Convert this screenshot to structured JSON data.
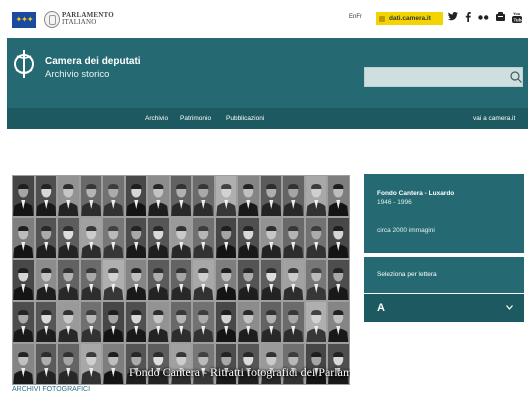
{
  "topbar": {
    "parliament_line1": "PARLAMENTO",
    "parliament_line2": "ITALIANO",
    "language": "EnFr",
    "dati_label": "dati.camera.it",
    "socials": [
      "twitter-icon",
      "facebook-icon",
      "flickr-icon",
      "rss-icon",
      "youtube-icon"
    ]
  },
  "header": {
    "title": "Camera dei deputati",
    "subtitle": "Archivio storico",
    "search_value": ""
  },
  "nav": {
    "items": [
      "Archivio",
      "Patrimonio",
      "Pubblicazioni"
    ],
    "external": "vai a camera.it"
  },
  "content": {
    "caption": "Fondo Cantera - Ritratti fotografici dei Parlamentari",
    "section_link": "ARCHIVI FOTOGRAFICI"
  },
  "panel": {
    "fondo_title": "Fondo Cantera - Luxardo",
    "fondo_years": "1946 - 1996",
    "fondo_count": "circa 2000 immagini",
    "select_label": "Seleziona per lettera",
    "select_value": "A"
  },
  "colors": {
    "teal": "#256a72",
    "teal_dark": "#1d5960",
    "search_bg": "#cfdedf",
    "dati_yellow": "#f3d400",
    "link_blue": "#2c6f89"
  }
}
